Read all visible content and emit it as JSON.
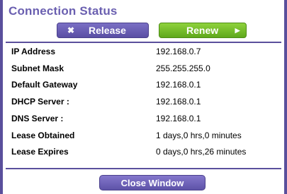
{
  "window": {
    "title": "Connection Status"
  },
  "actions": {
    "release_label": "Release",
    "renew_label": "Renew",
    "close_label": "Close Window"
  },
  "details": [
    {
      "label": "IP Address",
      "value": "192.168.0.7"
    },
    {
      "label": "Subnet Mask",
      "value": "255.255.255.0"
    },
    {
      "label": "Default Gateway",
      "value": "192.168.0.1"
    },
    {
      "label": "DHCP Server :",
      "value": "192.168.0.1"
    },
    {
      "label": "DNS Server :",
      "value": "192.168.0.1"
    },
    {
      "label": "Lease Obtained",
      "value": "1 days,0 hrs,0 minutes"
    },
    {
      "label": "Lease Expires",
      "value": "0 days,0 hrs,26 minutes"
    }
  ],
  "icons": {
    "release": "close-icon",
    "renew": "play-arrow-icon"
  },
  "colors": {
    "frame": "#5a4f9c",
    "title": "#6a5fb0",
    "release_button": "#6a5fb4",
    "renew_button": "#72bc2a"
  }
}
